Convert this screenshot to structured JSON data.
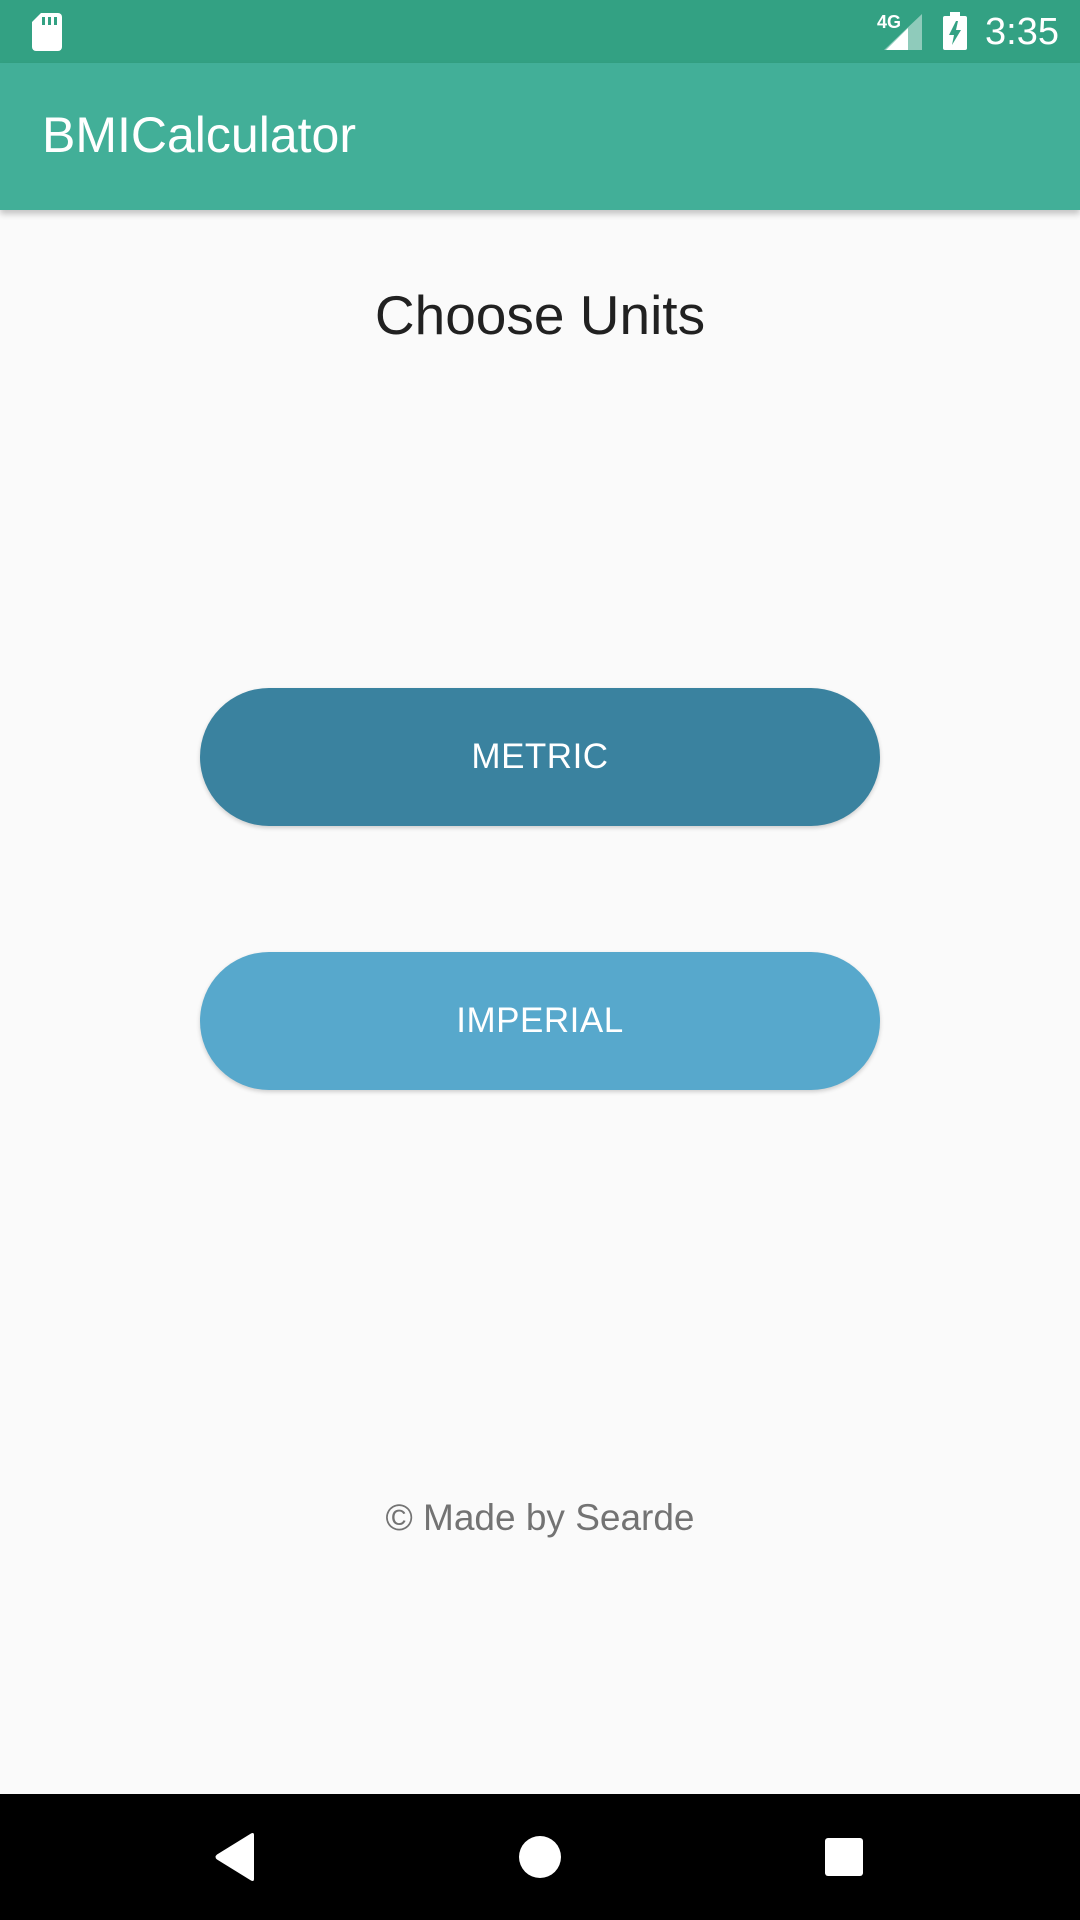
{
  "status_bar": {
    "time": "3:35",
    "network": "4G",
    "icons": [
      "sd-card-icon",
      "signal-icon",
      "battery-charging-icon"
    ]
  },
  "app_bar": {
    "title": "BMICalculator"
  },
  "main": {
    "heading": "Choose Units",
    "metric_label": "METRIC",
    "imperial_label": "IMPERIAL",
    "footer": "© Made by Searde"
  },
  "nav_bar": {
    "icons": [
      "back-icon",
      "home-icon",
      "recents-icon"
    ]
  },
  "colors": {
    "status_bar": "#33A183",
    "app_bar": "#42AF98",
    "metric_button": "#3A829F",
    "imperial_button": "#57A8CC",
    "background": "#FAFAFA"
  }
}
